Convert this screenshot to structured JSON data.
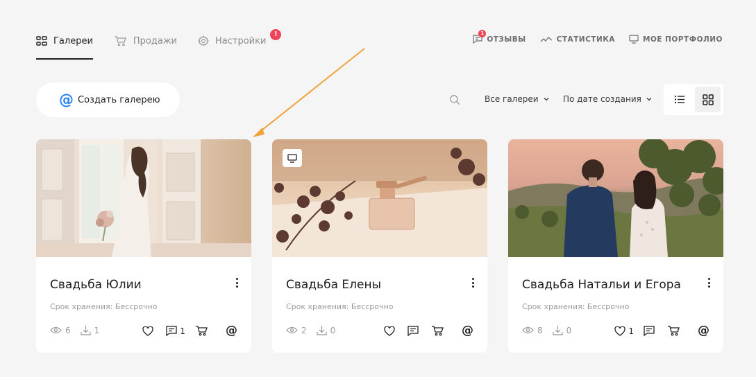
{
  "nav": {
    "galleries": "Галереи",
    "sales": "Продажи",
    "settings": "Настройки",
    "settings_badge": "!"
  },
  "nav_right": {
    "reviews": "ОТЗЫВЫ",
    "reviews_badge": "1",
    "stats": "СТАТИСТИКА",
    "portfolio": "МОЕ ПОРТФОЛИО"
  },
  "toolbar": {
    "create_label": "Создать галерею",
    "filter_label": "Все галереи",
    "sort_label": "По дате создания"
  },
  "cards": [
    {
      "title": "Свадьба Юлии",
      "storage": "Срок хранения: Бессрочно",
      "views": "6",
      "downloads": "1",
      "likes": "",
      "comments": "1"
    },
    {
      "title": "Свадьба Елены",
      "storage": "Срок хранения: Бессрочно",
      "views": "2",
      "downloads": "0",
      "likes": "",
      "comments": ""
    },
    {
      "title": "Свадьба Натальи и Егора",
      "storage": "Срок хранения: Бессрочно",
      "views": "8",
      "downloads": "0",
      "likes": "1",
      "comments": ""
    }
  ],
  "icons": {
    "galleries": "grid-icon",
    "sales": "cart-icon",
    "settings": "gear-icon",
    "reviews": "comment-icon",
    "stats": "trend-icon",
    "portfolio": "monitor-icon",
    "create": "at-icon",
    "search": "search-icon",
    "view_list": "list-icon",
    "view_grid": "grid-icon"
  },
  "colors": {
    "background": "#f5f5f5",
    "accent": "#2780ff",
    "badge": "#f0445a",
    "arrow": "#f0a33a"
  }
}
